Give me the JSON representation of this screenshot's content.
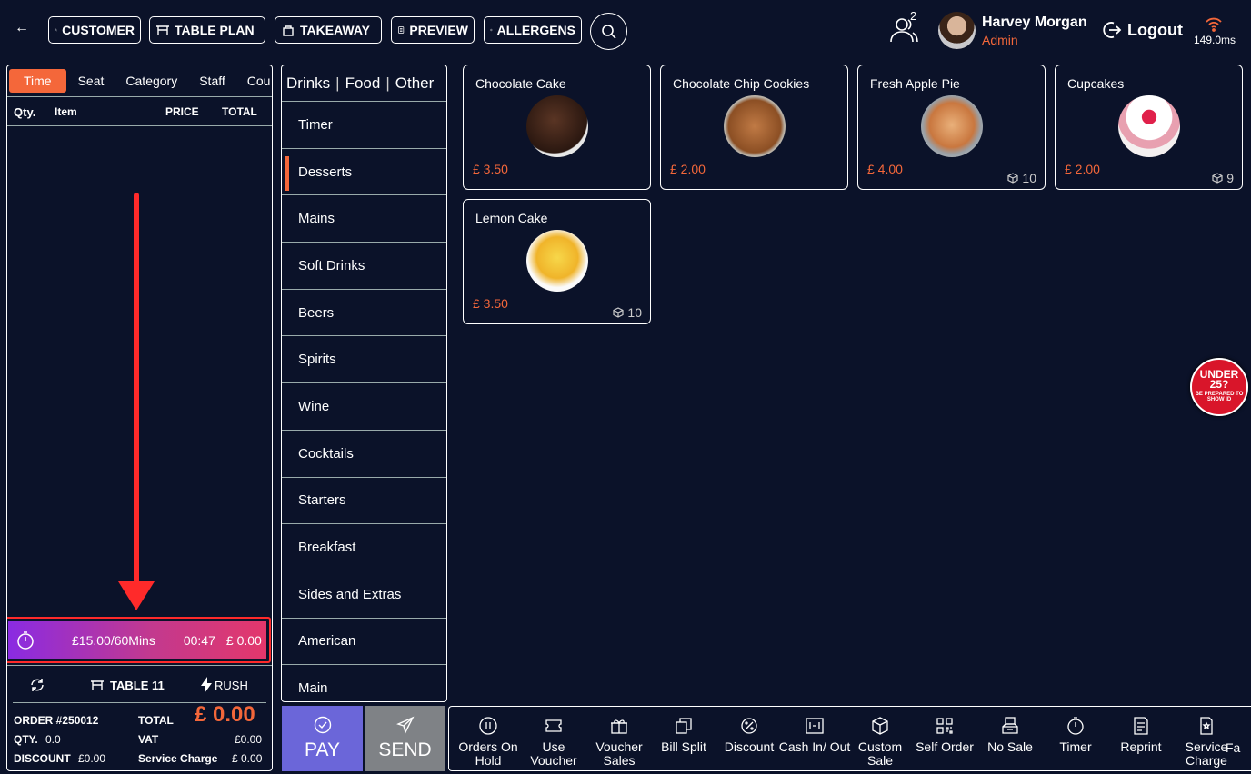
{
  "topbar": {
    "buttons": [
      "CUSTOMER",
      "TABLE PLAN",
      "TAKEAWAY",
      "PREVIEW",
      "ALLERGENS"
    ],
    "users_count": "2",
    "user_name": "Harvey Morgan",
    "user_role": "Admin",
    "logout_label": "Logout",
    "ping": "149.0ms"
  },
  "order": {
    "tabs": [
      "Time",
      "Seat",
      "Category",
      "Staff",
      "Cou"
    ],
    "columns": {
      "qty": "Qty.",
      "item": "Item",
      "price": "PRICE",
      "total": "TOTAL"
    },
    "timer": {
      "rate": "£15.00/60Mins",
      "elapsed": "00:47",
      "amount": "£ 0.00"
    },
    "table_label": "TABLE 11",
    "rush_label": "RUSH",
    "order_number": "ORDER #250012",
    "total_label": "TOTAL",
    "total_value": "£ 0.00",
    "qty_label": "QTY.",
    "qty_value": "0.0",
    "vat_label": "VAT",
    "vat_value": "£0.00",
    "discount_label": "DISCOUNT",
    "discount_value": "£0.00",
    "service_label": "Service Charge",
    "service_value": "£ 0.00"
  },
  "categories": {
    "tabs": [
      "Drinks",
      "Food",
      "Other"
    ],
    "items": [
      "Timer",
      "Desserts",
      "Mains",
      "Soft Drinks",
      "Beers",
      "Spirits",
      "Wine",
      "Cocktails",
      "Starters",
      "Breakfast",
      "Sides and Extras",
      "American",
      "Main"
    ],
    "active": "Desserts"
  },
  "products": [
    {
      "name": "Chocolate Cake",
      "price": "£ 3.50",
      "stock": ""
    },
    {
      "name": "Chocolate Chip Cookies",
      "price": "£ 2.00",
      "stock": ""
    },
    {
      "name": "Fresh Apple Pie",
      "price": "£ 4.00",
      "stock": "10"
    },
    {
      "name": "Cupcakes",
      "price": "£ 2.00",
      "stock": "9"
    },
    {
      "name": "Lemon Cake",
      "price": "£ 3.50",
      "stock": "10"
    }
  ],
  "badge": {
    "line1": "UNDER",
    "line2": "25?",
    "line3": "BE PREPARED TO SHOW ID"
  },
  "actions": {
    "pay": "PAY",
    "send": "SEND",
    "functions": [
      "Orders On Hold",
      "Use Voucher",
      "Voucher Sales",
      "Bill Split",
      "Discount",
      "Cash In/ Out",
      "Custom Sale",
      "Self Order",
      "No Sale",
      "Timer",
      "Reprint",
      "Service Charge",
      "Fa"
    ]
  },
  "colors": {
    "accent": "#f4673a",
    "background": "#0b1229",
    "pay": "#6b66d9",
    "send": "#7f8286",
    "highlight": "#ff2a2a"
  }
}
